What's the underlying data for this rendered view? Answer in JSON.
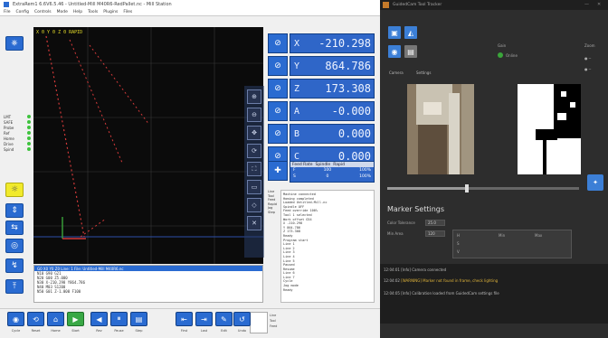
{
  "left_app": {
    "title": "ExtraRem1 6.6V6.5.46  -  Untitled-Mill M40R6-RedPallet.nc  -  Mill Station",
    "menu": [
      "File",
      "Config",
      "Controls",
      "Mode",
      "Help",
      "Tools",
      "Plugins",
      "Files"
    ],
    "viewport_label": "X 0  Y 0  Z 0 RAPID",
    "dro": [
      {
        "axis": "X",
        "value": "-210.298"
      },
      {
        "axis": "Y",
        "value": "864.786"
      },
      {
        "axis": "Z",
        "value": "173.308"
      },
      {
        "axis": "A",
        "value": "-0.000"
      },
      {
        "axis": "B",
        "value": "0.000"
      },
      {
        "axis": "C",
        "value": "0.000"
      }
    ],
    "feed": {
      "tabs": [
        "Feed Rate",
        "Spindle",
        "Rapid"
      ],
      "rows": [
        {
          "label": "F",
          "value": "100",
          "pct": "100%"
        },
        {
          "label": "S",
          "value": "0",
          "pct": "100%"
        }
      ]
    },
    "leds": [
      {
        "label": "LMT"
      },
      {
        "label": "SAFE"
      },
      {
        "label": "Probe"
      },
      {
        "label": "Ref"
      },
      {
        "label": "Home"
      },
      {
        "label": "Drive"
      },
      {
        "label": "Spind"
      }
    ],
    "gcode_header": "G0 X0 Y0 Z0  Line: 1  File: Untitled-Mill M40R6.nc",
    "gcode_lines": [
      "N10 G90 G21",
      "N20 G00 Z5.000",
      "N30 X-210.298 Y864.786",
      "N40 M03 S1200",
      "N50 G01 Z-1.000 F100"
    ],
    "log": [
      "Machine connected",
      "Homing completed",
      "Loaded Untitled-Mill.nc",
      "Spindle OFF",
      "Feed override 100%",
      "Tool 1 selected",
      "Work offset G54",
      "X -210.298",
      "Y 864.786",
      "Z 173.308",
      "Ready",
      "Program start",
      "Line 1",
      "Line 2",
      "Line 3",
      "Line 4",
      "Line 5",
      "Paused",
      "Resume",
      "Line 6",
      "Line 7",
      "Cycle",
      "Jog mode",
      "Ready"
    ],
    "bottom_buttons": [
      {
        "icon": "◉",
        "label": "Cycle"
      },
      {
        "icon": "⟲",
        "label": "Reset"
      },
      {
        "icon": "⌂",
        "label": "Home"
      },
      {
        "icon": "▶",
        "label": "Start",
        "green": true
      },
      {
        "icon": "◀",
        "label": "Rev"
      },
      {
        "icon": "⏸",
        "label": "Pause"
      },
      {
        "icon": "▤",
        "label": "Step"
      },
      {
        "icon": "⇤",
        "label": "First"
      },
      {
        "icon": "⇥",
        "label": "Last"
      },
      {
        "icon": "✎",
        "label": "Edit"
      },
      {
        "icon": "↺",
        "label": "Undo"
      }
    ],
    "side_status": [
      "Line",
      "Tool",
      "Feed",
      "Rapid",
      "Jog",
      "Step"
    ]
  },
  "right_app": {
    "title": "GuidedCam  Tool Tracker",
    "buttons": [
      "camera",
      "move"
    ],
    "tabs": [
      "Camera",
      "Settings"
    ],
    "status_labels": [
      "Online",
      "Gain",
      "Zoom"
    ],
    "section_title": "Marker Settings",
    "fields": [
      {
        "label": "Color Tolerance",
        "value": "25.0"
      },
      {
        "label": "Min Area",
        "value": "120"
      }
    ],
    "table_labels": [
      "H",
      "S",
      "V",
      "Min",
      "Max"
    ],
    "console_rows": [
      {
        "time": "12:04:01",
        "tag": "[Info]",
        "text": "Camera connected"
      },
      {
        "time": "12:04:02",
        "tag": "[WARNING]",
        "text": "Marker not found in frame, check lighting"
      },
      {
        "time": "12:04:05",
        "tag": "[Info]",
        "text": "Calibration loaded from GuidedCam settings file"
      }
    ],
    "colors": {
      "accent": "#3c7fd6",
      "panel": "#2d2d2d",
      "warning": "#e0b43a"
    }
  }
}
